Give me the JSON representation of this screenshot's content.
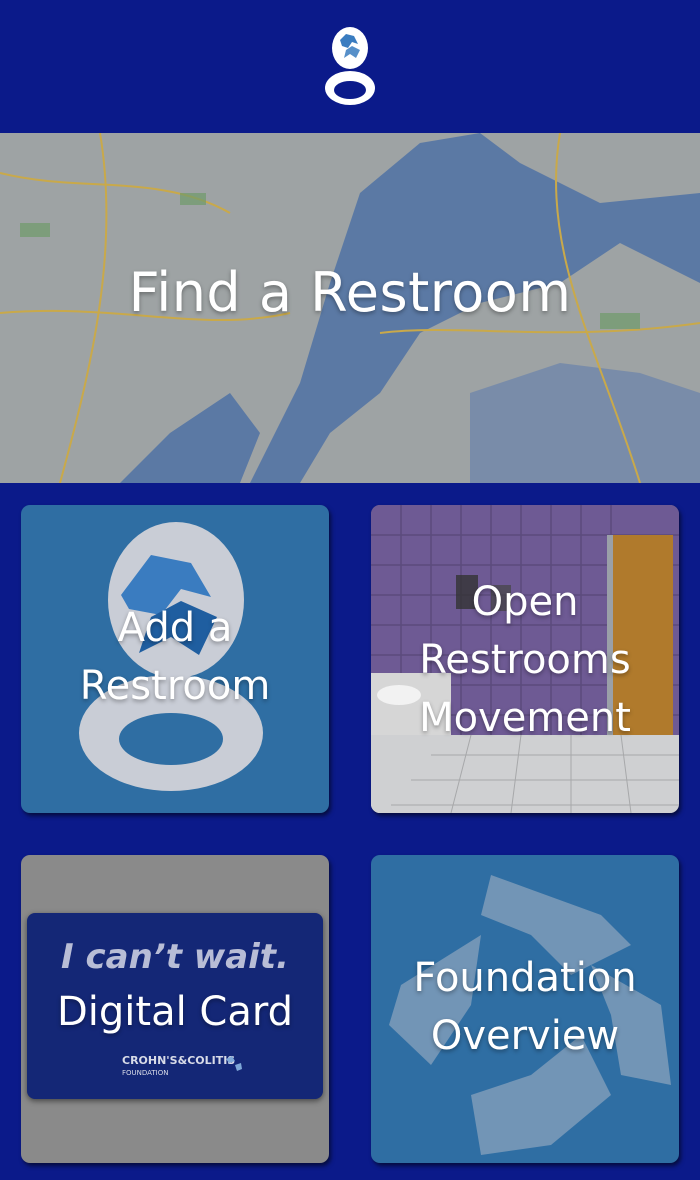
{
  "header": {
    "logo_icon": "toilet-seat-logo-icon"
  },
  "map_banner": {
    "title": "Find a Restroom"
  },
  "tiles": [
    {
      "label_line1": "Add a",
      "label_line2": "Restroom",
      "icon": "toilet-seat-icon"
    },
    {
      "label_line1": "Open",
      "label_line2": "Restrooms",
      "label_line3": "Movement"
    },
    {
      "label_line1": "Digital Card",
      "card_tagline": "I can’t wait.",
      "card_brand": "CROHN'S&COLITIS",
      "card_brand_sub": "FOUNDATION"
    },
    {
      "label_line1": "Foundation",
      "label_line2": "Overview",
      "icon": "foundation-star-icon"
    }
  ],
  "colors": {
    "background": "#0b1a8a",
    "tile_blue": "#2f6ea3",
    "restroom_wall": "#7a66a6"
  }
}
